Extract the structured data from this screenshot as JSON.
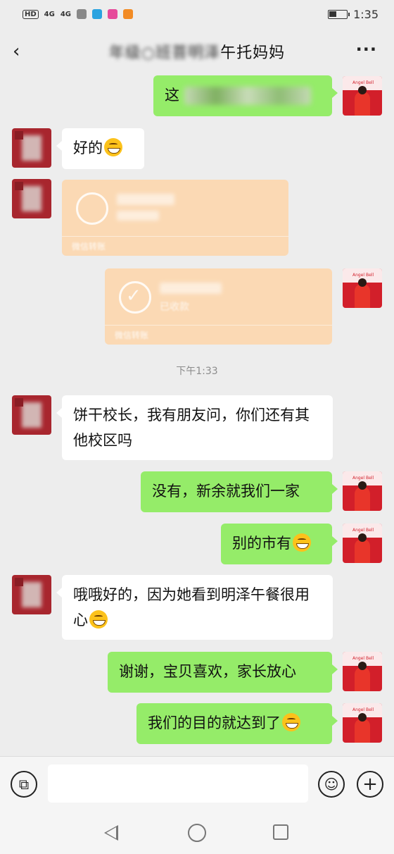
{
  "status_bar": {
    "hd": "HD",
    "signal1": "4G",
    "signal2": "4G",
    "time": "1:35"
  },
  "header": {
    "title": "午托妈妈",
    "title_blurred_prefix": "年级○班菩明泽",
    "more": "···"
  },
  "messages": {
    "m1_text": "这",
    "m2_text": "好的",
    "timestamp": "下午1:33",
    "m3_text": "饼干校长，我有朋友问，你们还有其他校区吗",
    "m4_text": "没有，新余就我们一家",
    "m5_text": "别的市有",
    "m6_text": "哦哦好的，因为她看到明泽午餐很用心",
    "m7_text": "谢谢，宝贝喜欢，家长放心",
    "m8_text": "我们的目的就达到了"
  },
  "transfer": {
    "received_label": "已收款",
    "footer_label": "微信转账"
  },
  "avatar_self": {
    "banner_text": "Angel Bell"
  },
  "colors": {
    "background": "#ededed",
    "bubble_green": "#95ec69",
    "bubble_white": "#ffffff",
    "transfer_orange": "#fbd9b4",
    "avatar_red": "#d21f2a"
  }
}
